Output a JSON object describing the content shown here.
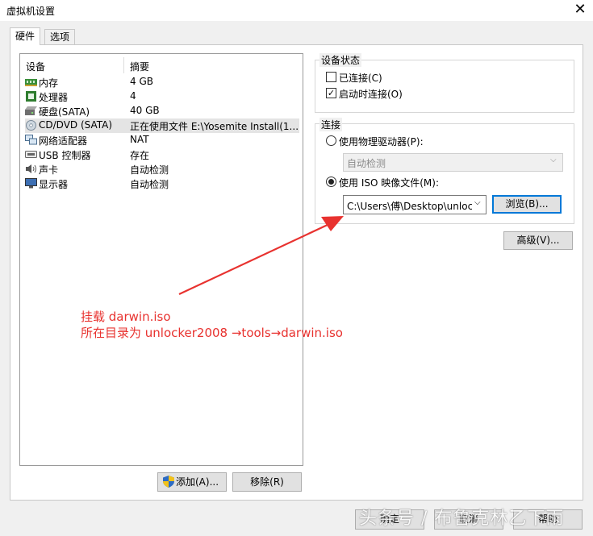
{
  "window": {
    "title": "虚拟机设置"
  },
  "tabs": [
    {
      "label": "硬件"
    },
    {
      "label": "选项"
    }
  ],
  "device_list": {
    "columns": {
      "device": "设备",
      "summary": "摘要"
    },
    "rows": [
      {
        "icon": "memory-icon",
        "name": "内存",
        "summary": "4 GB"
      },
      {
        "icon": "processor-icon",
        "name": "处理器",
        "summary": "4"
      },
      {
        "icon": "hard-disk-icon",
        "name": "硬盘(SATA)",
        "summary": "40 GB"
      },
      {
        "icon": "cd-dvd-icon",
        "name": "CD/DVD (SATA)",
        "summary": "正在使用文件 E:\\Yosemite Install(1...",
        "selected": true
      },
      {
        "icon": "network-adapter-icon",
        "name": "网络适配器",
        "summary": "NAT"
      },
      {
        "icon": "usb-icon",
        "name": "USB 控制器",
        "summary": "存在"
      },
      {
        "icon": "sound-card-icon",
        "name": "声卡",
        "summary": "自动检测"
      },
      {
        "icon": "display-icon",
        "name": "显示器",
        "summary": "自动检测"
      }
    ]
  },
  "device_status": {
    "title": "设备状态",
    "connected": {
      "label": "已连接(C)",
      "checked": false
    },
    "connect_at_power_on": {
      "label": "启动时连接(O)",
      "checked": true
    }
  },
  "connection": {
    "title": "连接",
    "physical_drive": {
      "label": "使用物理驱动器(P):",
      "selected": false
    },
    "physical_drive_value": "自动检测",
    "iso": {
      "label": "使用 ISO 映像文件(M):",
      "selected": true
    },
    "iso_path": "C:\\Users\\傅\\Desktop\\unlock",
    "browse": "浏览(B)...",
    "advanced": "高级(V)..."
  },
  "buttons": {
    "add": "添加(A)...",
    "remove": "移除(R)",
    "ok": "确定",
    "cancel": "取消",
    "help": "帮助"
  },
  "annotation": {
    "line1": "挂载 darwin.iso",
    "line2": "所在目录为 unlocker2008 →tools→darwin.iso",
    "color": "#e8322f"
  },
  "watermark": "头条号 / 布鲁克林乙下雨"
}
